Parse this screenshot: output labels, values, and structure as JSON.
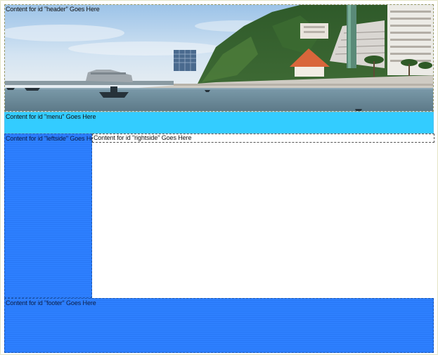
{
  "regions": {
    "header": {
      "label": "Content for id \"header\" Goes Here"
    },
    "menu": {
      "label": "Content for id \"menu\" Goes Here"
    },
    "leftside": {
      "label": "Content for id \"leftside\" Goes Here"
    },
    "rightside": {
      "label": "Content for id \"rightside\" Goes Here"
    },
    "footer": {
      "label": "Content for id \"footer\" Goes Here"
    }
  },
  "colors": {
    "page_background": "#fbfbe6",
    "menu": "#33ccff",
    "sidebar_footer": "#2e80ff",
    "content": "#ffffff"
  },
  "images": {
    "header_photo": "seaside-town-panorama"
  }
}
